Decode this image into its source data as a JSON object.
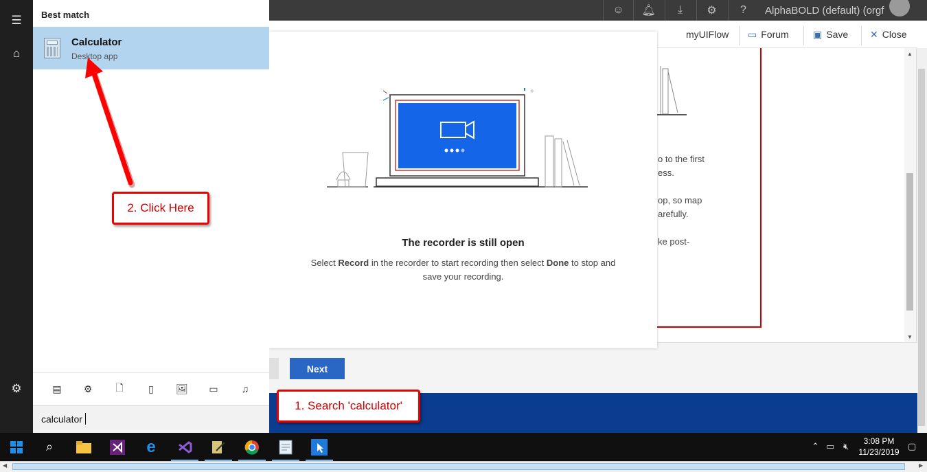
{
  "topbar": {
    "org": "AlphaBOLD (default) (orgf",
    "icons": [
      "smiley-icon",
      "bell-icon",
      "download-icon",
      "gear-icon",
      "help-icon"
    ]
  },
  "commandbar": {
    "flow_name": "myUIFlow",
    "forum_label": "Forum",
    "save_label": "Save",
    "close_label": "Close"
  },
  "panel": {
    "line1": "o to the first",
    "line2": "ess.",
    "line3": "op, so map",
    "line4": "arefully.",
    "line5": "ke post-"
  },
  "modal": {
    "title": "The recorder is still open",
    "desc_a": "Select ",
    "desc_record": "Record",
    "desc_b": " in the recorder to start recording then select ",
    "desc_done": "Done",
    "desc_c": " to stop and save your recording."
  },
  "footer": {
    "next_label": "Next"
  },
  "start_menu": {
    "section": "Best match",
    "result_name": "Calculator",
    "result_type": "Desktop app",
    "search_value": "calculator"
  },
  "callouts": {
    "step1": "1. Search 'calculator'",
    "step2": "2. Click Here"
  },
  "clock": {
    "time": "3:08 PM",
    "date": "11/23/2019"
  },
  "colors": {
    "accent": "#2a66c4",
    "callout_red": "#e00000",
    "selection": "#b3d4ee"
  }
}
